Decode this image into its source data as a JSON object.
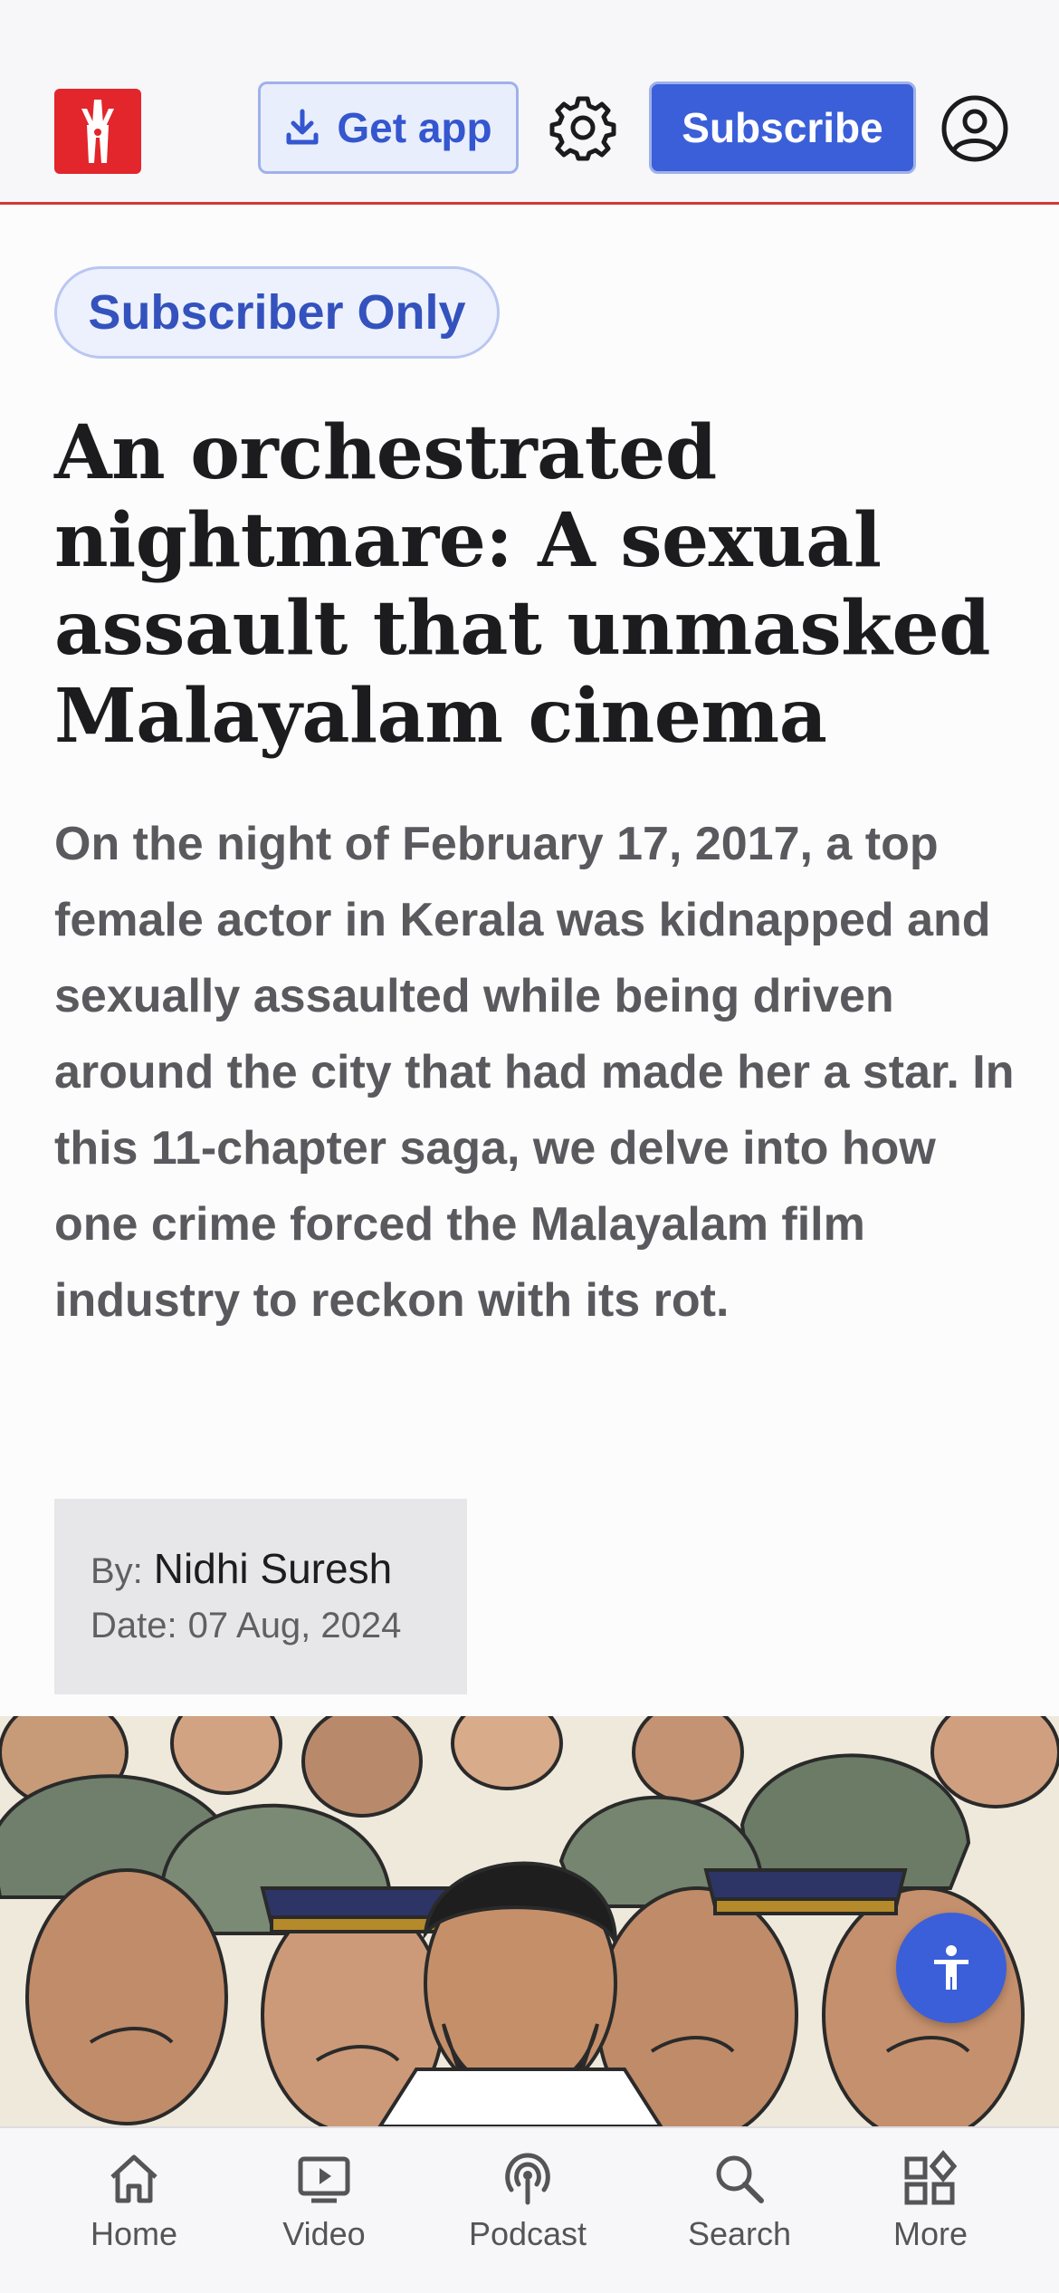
{
  "header": {
    "logo_icon": "clothespin-logo-icon",
    "get_app_label": "Get app",
    "settings_icon": "gear-icon",
    "subscribe_label": "Subscribe",
    "account_icon": "user-circle-icon"
  },
  "article": {
    "badge": "Subscriber Only",
    "headline_lines": [
      "An orchestrated",
      "nightmare: A sexual",
      "assault that unmasked",
      "Malayalam cinema"
    ],
    "summary": "On the night of February 17, 2017, a top female actor in Kerala was kidnapped and sexually assaulted while being driven around the city that had made her a star. In this 11-chapter saga, we delve into how one crime forced the Malayalam film industry to reckon with its rot.",
    "byline": {
      "by_label": "By:",
      "author": "Nidhi Suresh",
      "date_label": "Date:",
      "date": "07 Aug, 2024"
    }
  },
  "accessibility_button_icon": "accessibility-icon",
  "bottom_nav": [
    {
      "label": "Home",
      "icon": "home-icon"
    },
    {
      "label": "Video",
      "icon": "video-icon"
    },
    {
      "label": "Podcast",
      "icon": "podcast-icon"
    },
    {
      "label": "Search",
      "icon": "search-icon"
    },
    {
      "label": "More",
      "icon": "grid-icon"
    }
  ],
  "colors": {
    "accent": "#3b5fd8",
    "brand_red": "#e2262c",
    "badge_text": "#3452bd"
  }
}
